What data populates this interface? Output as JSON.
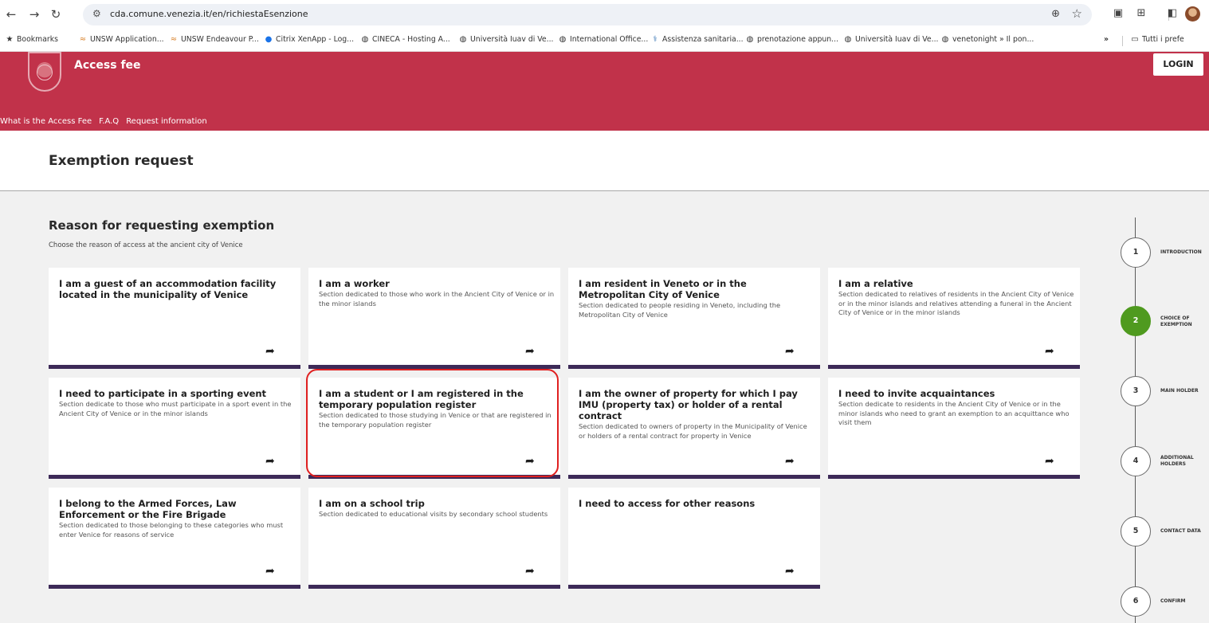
{
  "browser": {
    "url": "cda.comune.venezia.it/en/richiestaEsenzione",
    "bookmarks": [
      {
        "label": "Bookmarks",
        "icon": "star-icon"
      },
      {
        "label": "UNSW Application...",
        "icon": "unsw-icon"
      },
      {
        "label": "UNSW Endeavour P...",
        "icon": "unsw-icon"
      },
      {
        "label": "Citrix XenApp - Log...",
        "icon": "citrix-icon"
      },
      {
        "label": "CINECA - Hosting A...",
        "icon": "globe-icon"
      },
      {
        "label": "Università Iuav di Ve...",
        "icon": "globe-icon"
      },
      {
        "label": "International Office...",
        "icon": "globe-icon"
      },
      {
        "label": "Assistenza sanitaria...",
        "icon": "health-icon"
      },
      {
        "label": "prenotazione appun...",
        "icon": "globe-icon"
      },
      {
        "label": "Università Iuav di Ve...",
        "icon": "globe-icon"
      },
      {
        "label": "venetonight » Il pon...",
        "icon": "globe-icon"
      }
    ],
    "more_label": "»",
    "all_bookmarks_label": "Tutti i prefe"
  },
  "header": {
    "title": "Access fee",
    "login_label": "LOGIN",
    "nav": [
      "What is the Access Fee",
      "F.A.Q",
      "Request information"
    ],
    "color": "#c1324a"
  },
  "page": {
    "title": "Exemption request",
    "section_title": "Reason for requesting exemption",
    "section_subtitle": "Choose the reason of access at the ancient city of Venice"
  },
  "cards": [
    {
      "title": "I am a guest of an accommodation facility located in the municipality of Venice",
      "desc": ""
    },
    {
      "title": "I am a worker",
      "desc": "Section dedicated to those who work in the Ancient City of Venice or in the minor islands"
    },
    {
      "title": "I am resident in Veneto or in the Metropolitan City of Venice",
      "desc": "Section dedicated to people residing in Veneto, including the Metropolitan City of Venice"
    },
    {
      "title": "I am a relative",
      "desc": "Section dedicated to relatives of residents in the Ancient City of Venice or in the minor islands and relatives attending a funeral in the Ancient City of Venice or in the minor islands"
    },
    {
      "title": "I need to participate in a sporting event",
      "desc": "Section dedicate to those who must participate in a sport event in the Ancient City of Venice or in the minor islands"
    },
    {
      "title": "I am a student or I am registered in the temporary population register",
      "desc": "Section dedicated to those studying in Venice or that are registered in the temporary population register"
    },
    {
      "title": "I am the owner of property for which I pay IMU (property tax) or holder of a rental contract",
      "desc": "Section dedicated to owners of property in the Municipality of Venice or holders of a rental contract for property in Venice"
    },
    {
      "title": "I need to invite acquaintances",
      "desc": "Section dedicate to residents in the Ancient City of Venice or in the minor islands who need to grant an exemption to an acquittance who visit them"
    },
    {
      "title": "I belong to the Armed Forces, Law Enforcement or the Fire Brigade",
      "desc": "Section dedicated to those belonging to these categories who must enter Venice for reasons of service"
    },
    {
      "title": "I am on a school trip",
      "desc": "Section dedicated to educational visits by secondary school students"
    },
    {
      "title": "I need to access for other reasons",
      "desc": ""
    }
  ],
  "steps": [
    {
      "num": "1",
      "label": "INTRODUCTION",
      "active": false
    },
    {
      "num": "2",
      "label": "CHOICE OF EXEMPTION",
      "active": true
    },
    {
      "num": "3",
      "label": "MAIN HOLDER",
      "active": false
    },
    {
      "num": "4",
      "label": "ADDITIONAL HOLDERS",
      "active": false
    },
    {
      "num": "5",
      "label": "CONTACT DATA",
      "active": false
    },
    {
      "num": "6",
      "label": "CONFIRM",
      "active": false
    }
  ],
  "colors": {
    "accent": "#c1324a",
    "card_border": "#3d2a58",
    "active_step": "#4f9a1f",
    "highlight": "#e02020"
  }
}
